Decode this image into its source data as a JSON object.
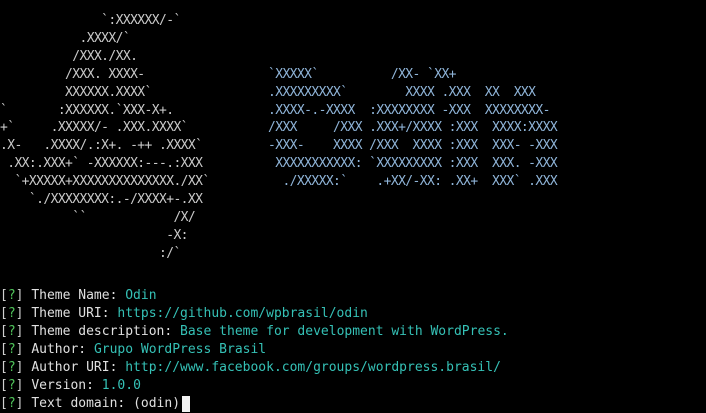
{
  "colors": {
    "background": "#000000",
    "logo": "#c9c9c9",
    "text_art": "#8fb4d8",
    "question_mark": "#4fc35a",
    "value": "#35c1b6",
    "label": "#e0e0e0"
  },
  "ascii_logo": [
    "              `:XXXXXX/-`",
    "           .XXXX/`",
    "          /XXX./XX.",
    "         /XXX. XXXX-",
    "         XXXXXX.XXXX`",
    "`       :XXXXXX.`XXX-X+.",
    "+`     .XXXXX/- .XXX.XXXX`",
    ".X-   .XXXX/.:X+. -++ .XXXX`",
    " .XX:.XXX+` -XXXXXX:---.:XXX",
    "  `+XXXXX+XXXXXXXXXXXXXX./XX`",
    "    `./XXXXXXXX:.-/XXXX+-.XX",
    "          ``            /X/",
    "                       -X:",
    "                      :/`"
  ],
  "ascii_text": [
    "",
    "",
    "",
    "`XXXXX`          /XX- `XX+",
    ".XXXXXXXXX`        XXXX .XXX  XX  XXX",
    ".XXXX-.-XXXX  :XXXXXXXX -XXX  XXXXXXXX-",
    "/XXX     /XXX .XXX+/XXXX :XXX  XXXX:XXXX",
    "-XXX-    XXXX /XXX  XXXX :XXX  XXX- -XXX",
    " XXXXXXXXXXX: `XXXXXXXXX :XXX  XXX. -XXX",
    "  ./XXXXX:`    .+XX/-XX: .XX+  XXX` .XXX"
  ],
  "prompts": [
    {
      "open": "[",
      "mark": "?",
      "close": "] ",
      "label": "Theme Name: ",
      "value": "Odin"
    },
    {
      "open": "[",
      "mark": "?",
      "close": "] ",
      "label": "Theme URI: ",
      "value": "https://github.com/wpbrasil/odin"
    },
    {
      "open": "[",
      "mark": "?",
      "close": "] ",
      "label": "Theme description: ",
      "value": "Base theme for development with WordPress."
    },
    {
      "open": "[",
      "mark": "?",
      "close": "] ",
      "label": "Author: ",
      "value": "Grupo WordPress Brasil"
    },
    {
      "open": "[",
      "mark": "?",
      "close": "] ",
      "label": "Author URI: ",
      "value": "http://www.facebook.com/groups/wordpress.brasil/"
    },
    {
      "open": "[",
      "mark": "?",
      "close": "] ",
      "label": "Version: ",
      "value": "1.0.0"
    },
    {
      "open": "[",
      "mark": "?",
      "close": "] ",
      "label": "Text domain: ",
      "value": "(odin)"
    }
  ]
}
